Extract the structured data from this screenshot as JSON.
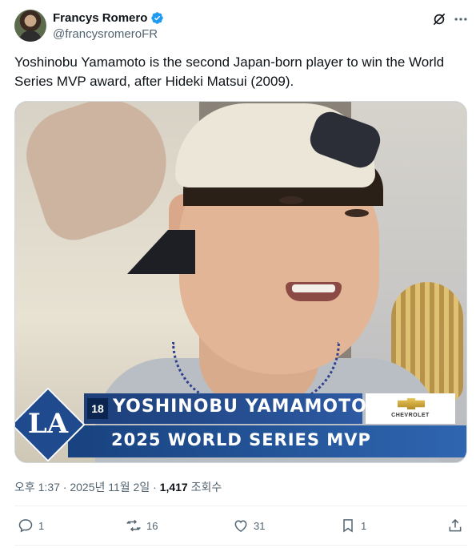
{
  "author": {
    "display_name": "Francys Romero",
    "handle": "@francysromeroFR",
    "verified_color": "#1d9bf0",
    "avatar_icon": "profile-photo"
  },
  "tweet": {
    "text": "Yoshinobu Yamamoto is the second Japan-born player to win the World Series MVP award, after Hideki Matsui (2009)."
  },
  "media": {
    "logo_text": "LA",
    "jersey_number": "18",
    "player_name": "YOSHINOBU YAMAMOTO",
    "caption": "2025 WORLD SERIES MVP",
    "sponsor": "CHEVROLET",
    "team_color": "#1f4b8e"
  },
  "meta": {
    "timestamp": "오후 1:37 · 2025년 11월 2일 · ",
    "views_count": "1,417",
    "views_label": " 조회수"
  },
  "actions": {
    "replies": "1",
    "reposts": "16",
    "likes": "31",
    "bookmarks": "1"
  },
  "icons": [
    "verified-badge-icon",
    "grok-icon",
    "more-icon",
    "reply-icon",
    "repost-icon",
    "like-icon",
    "bookmark-icon",
    "share-icon"
  ]
}
